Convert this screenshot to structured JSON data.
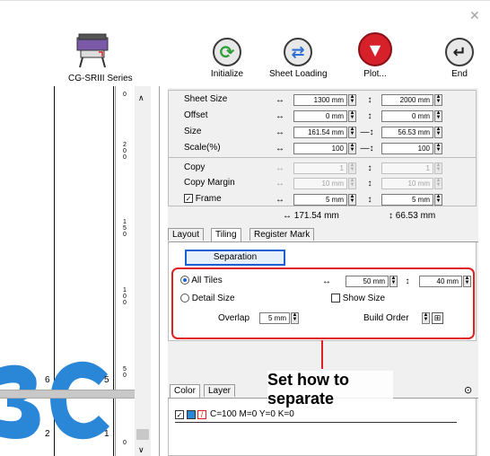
{
  "window": {
    "close_icon": "close-icon"
  },
  "device": {
    "name": "CG-SRIII Series",
    "icon": "plotter-icon"
  },
  "toolbar": [
    {
      "name": "initialize-button",
      "label": "Initialize",
      "icon": "refresh-icon",
      "glyph": "⟳",
      "color": "#2e9e3a"
    },
    {
      "name": "sheet-loading-button",
      "label": "Sheet Loading",
      "icon": "swap-arrows-icon",
      "glyph": "⇄",
      "color": "#2c6fd1"
    },
    {
      "name": "plot-button",
      "label": "Plot...",
      "icon": "plot-cutter-icon",
      "glyph": "▼",
      "color": "#d6202a"
    },
    {
      "name": "end-button",
      "label": "End",
      "icon": "return-icon",
      "glyph": "↵",
      "color": "#222222"
    }
  ],
  "ruler": {
    "top_label": "0",
    "marks": [
      "2\n0\n0",
      "1\n5\n0",
      "1\n0\n0",
      "5\n0",
      "0"
    ]
  },
  "canvas": {
    "text": "3C",
    "color": "#2a86d6",
    "numbers": [
      "6",
      "5",
      "2",
      "1"
    ]
  },
  "props": {
    "sheet_size": {
      "label": "Sheet Size",
      "w": "1300 mm",
      "h": "2000 mm"
    },
    "offset": {
      "label": "Offset",
      "w": "0 mm",
      "h": "0 mm"
    },
    "size": {
      "label": "Size",
      "w": "161.54 mm",
      "h": "56.53 mm"
    },
    "scale": {
      "label": "Scale(%)",
      "w": "100",
      "h": "100"
    },
    "copy": {
      "label": "Copy",
      "w": "1",
      "h": "1"
    },
    "copy_margin": {
      "label": "Copy Margin",
      "w": "10 mm",
      "h": "10 mm"
    },
    "frame": {
      "label": "Frame",
      "w": "5 mm",
      "h": "5 mm",
      "checked": true
    },
    "total_w": "↔ 171.54 mm",
    "total_h": "↕ 66.53 mm"
  },
  "tabs": [
    "Layout",
    "Tiling",
    "Register Mark"
  ],
  "tiling": {
    "separation_label": "Separation",
    "all_tiles_label": "All Tiles",
    "all_tiles_w": "50 mm",
    "all_tiles_h": "40 mm",
    "detail_size_label": "Detail Size",
    "show_size_label": "Show Size",
    "overlap_label": "Overlap",
    "overlap_value": "5 mm",
    "build_order_label": "Build Order"
  },
  "callout": {
    "text": "Set how to separate",
    "color": "#e02020"
  },
  "bottom_tabs": [
    "Color",
    "Layer"
  ],
  "layer_item": "C=100 M=0 Y=0 K=0",
  "next_icon": "circle-arrow-right-icon"
}
